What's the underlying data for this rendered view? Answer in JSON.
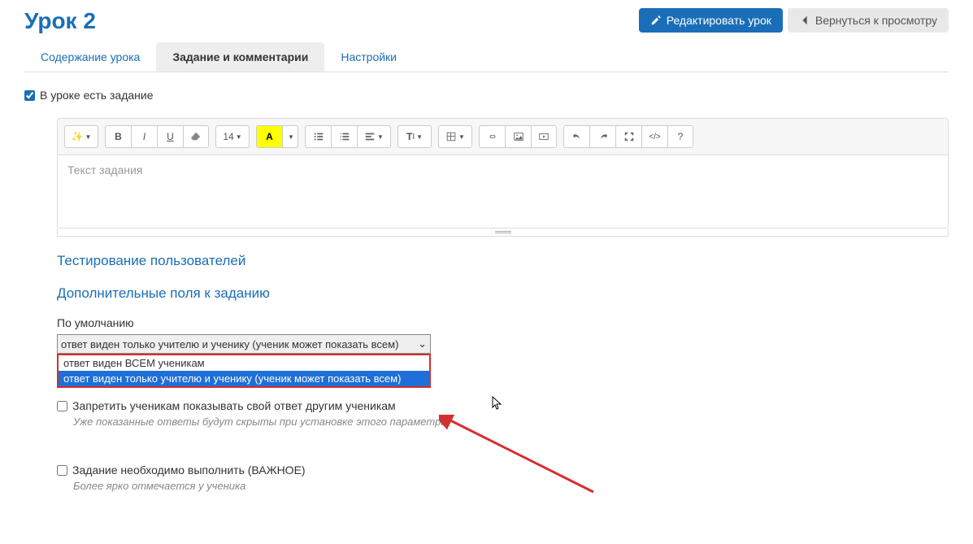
{
  "header": {
    "title": "Урок 2",
    "edit_button": "Редактировать урок",
    "back_button": "Вернуться к просмотру"
  },
  "tabs": [
    {
      "label": "Содержание урока",
      "active": false
    },
    {
      "label": "Задание и комментарии",
      "active": true
    },
    {
      "label": "Настройки",
      "active": false
    }
  ],
  "has_task_checkbox": {
    "label": "В уроке есть задание",
    "checked": true
  },
  "editor": {
    "placeholder": "Текст задания",
    "fontsize": "14"
  },
  "sections": {
    "testing": "Тестирование пользователей",
    "additional": "Дополнительные поля к заданию"
  },
  "visibility": {
    "label": "По умолчанию",
    "selected": "ответ виден только учителю и ученику (ученик может показать всем)",
    "options": [
      "ответ виден ВСЕМ ученикам",
      "ответ виден только учителю и ученику (ученик может показать всем)"
    ]
  },
  "forbid_checkbox": {
    "label": "Запретить ученикам показывать свой ответ другим ученикам",
    "hint": "Уже показанные ответы будут скрыты при установке этого параметра"
  },
  "important_checkbox": {
    "label": "Задание необходимо выполнить (ВАЖНОЕ)",
    "hint": "Более ярко отмечается у ученика"
  }
}
